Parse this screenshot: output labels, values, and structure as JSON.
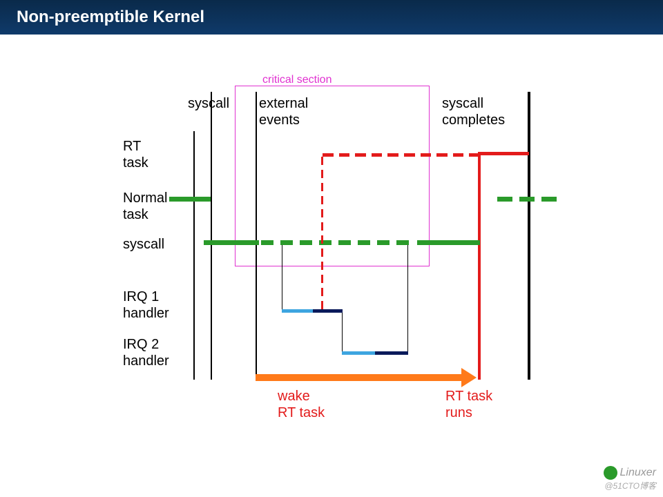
{
  "header": {
    "title": "Non-preemptible  Kernel"
  },
  "labels": {
    "critical_section": "critical section",
    "syscall_top": "syscall",
    "external_events_l1": "external",
    "external_events_l2": " events",
    "syscall_completes_l1": "syscall",
    "syscall_completes_l2": "completes",
    "rt_task_l1": "RT",
    "rt_task_l2": "task",
    "normal_l1": "Normal",
    "normal_l2": "task",
    "syscall_row": "syscall",
    "irq1_l1": "IRQ 1",
    "irq1_l2": "handler",
    "irq2_l1": "IRQ 2",
    "irq2_l2": "handler",
    "wake_l1": "wake",
    "wake_l2": "RT task",
    "rtruns_l1": "RT task",
    "rtruns_l2": "runs"
  },
  "watermark": {
    "brand": "Linuxer",
    "sub": "@51CTO博客"
  },
  "chart_data": {
    "type": "timeline",
    "title": "Non-preemptible Kernel scheduling latency (critical section blocks RT task)",
    "x_events": [
      "syscall",
      "external events (IRQ 1, IRQ 2)",
      "syscall completes",
      "RT task runs"
    ],
    "rows": [
      {
        "name": "RT task",
        "segments": [
          {
            "state": "ready (dashed)",
            "from": "wake RT task (during IRQ1)",
            "to": "syscall completes"
          },
          {
            "state": "running (solid)",
            "from": "syscall completes",
            "to": "end"
          }
        ]
      },
      {
        "name": "Normal task",
        "segments": [
          {
            "state": "running",
            "from": "start",
            "to": "syscall"
          },
          {
            "state": "resumes (dashed)",
            "from": "after RT runs",
            "to": "end"
          }
        ]
      },
      {
        "name": "syscall (kernel)",
        "segments": [
          {
            "state": "running (solid)",
            "from": "syscall",
            "to": "external events"
          },
          {
            "state": "interrupted (dashed)",
            "from": "external events",
            "to": "IRQ handlers done"
          },
          {
            "state": "running (solid)",
            "from": "IRQ handlers done",
            "to": "syscall completes"
          }
        ]
      },
      {
        "name": "IRQ 1 handler",
        "segments": [
          {
            "state": "running",
            "from": "external events",
            "to": "mid"
          }
        ]
      },
      {
        "name": "IRQ 2 handler",
        "segments": [
          {
            "state": "running",
            "from": "mid",
            "to": "syscall resume"
          }
        ]
      }
    ],
    "critical_section": {
      "from": "just after syscall",
      "to": "just before syscall completes"
    },
    "latency_arrow": {
      "label": "wake RT task → RT task runs",
      "from": "external events",
      "to": "syscall completes"
    }
  }
}
